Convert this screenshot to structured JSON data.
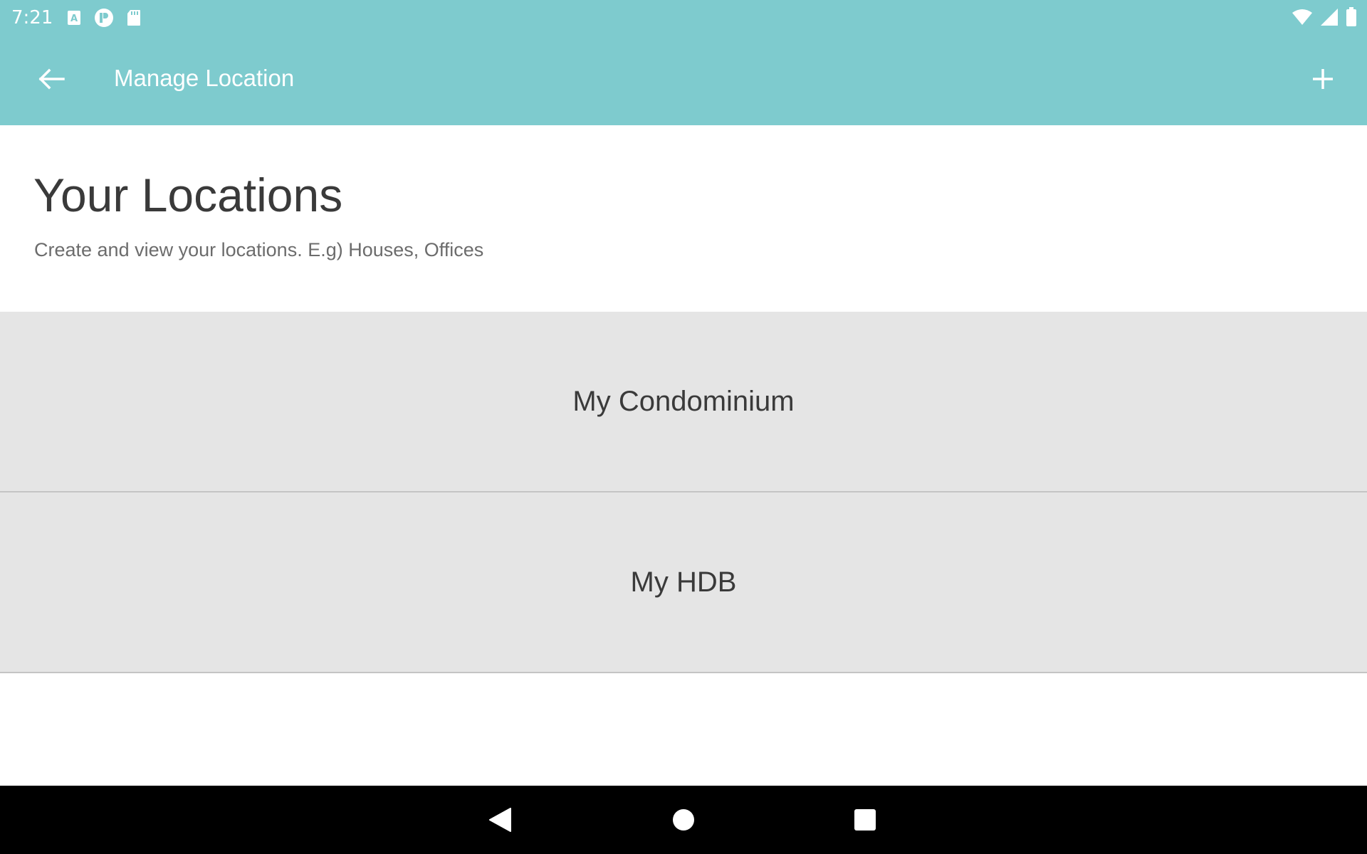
{
  "status_bar": {
    "time": "7:21",
    "left_icons": [
      "keyboard-a-icon",
      "p-app-icon",
      "sd-card-icon"
    ],
    "right_icons": [
      "wifi-icon",
      "signal-icon",
      "battery-icon"
    ]
  },
  "app_bar": {
    "title": "Manage Location",
    "back_icon": "arrow-left-icon",
    "add_icon": "plus-icon"
  },
  "header": {
    "title": "Your Locations",
    "subtitle": "Create and view your locations. E.g) Houses, Offices"
  },
  "locations": [
    {
      "label": "My Condominium"
    },
    {
      "label": "My HDB"
    }
  ],
  "nav_bar": {
    "buttons": [
      "back-triangle-icon",
      "home-circle-icon",
      "recents-square-icon"
    ]
  },
  "colors": {
    "accent": "#7ecbce",
    "list_item_bg": "#e5e5e5",
    "text_dark": "#3a3a3a",
    "text_muted": "#6c6c6c"
  }
}
